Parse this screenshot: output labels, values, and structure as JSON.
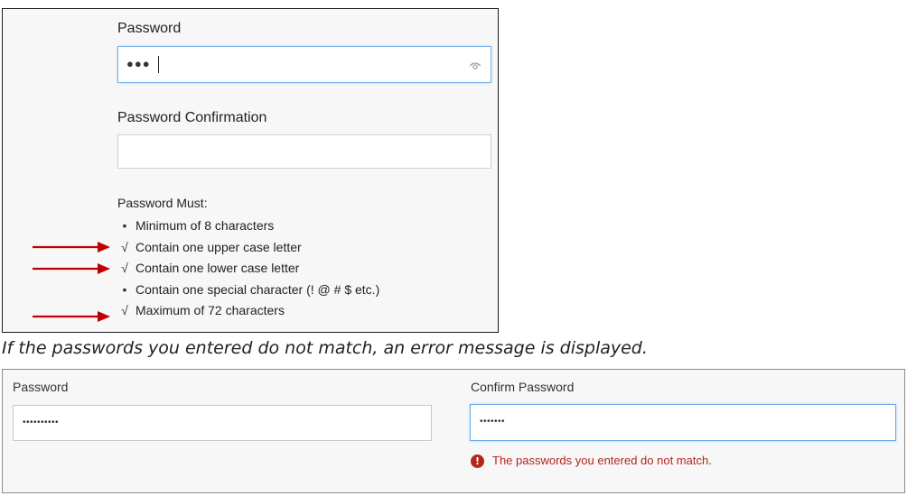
{
  "top_panel": {
    "password_label": "Password",
    "password_masked": "●●●",
    "confirmation_label": "Password Confirmation",
    "confirmation_value": "",
    "rules_title": "Password Must:",
    "rules": [
      {
        "mark": "•",
        "text": "Minimum of 8 characters",
        "met": false,
        "highlighted": false
      },
      {
        "mark": "√",
        "text": "Contain one upper case letter",
        "met": true,
        "highlighted": true
      },
      {
        "mark": "√",
        "text": "Contain one lower case letter",
        "met": true,
        "highlighted": true
      },
      {
        "mark": "•",
        "text": "Contain one special character (! @ # $ etc.)",
        "met": false,
        "highlighted": false
      },
      {
        "mark": "√",
        "text": "Maximum of 72 characters",
        "met": true,
        "highlighted": true
      }
    ],
    "arrow_color": "#c00000",
    "icons": {
      "password_toggle": "eye-icon",
      "pointer": "arrow-right-icon"
    }
  },
  "caption": "If the passwords you entered do not match, an error message is displayed.",
  "bottom_panel": {
    "password_label": "Password",
    "password_masked": "••••••••••",
    "confirm_label": "Confirm Password",
    "confirm_masked": "•••••••",
    "error_message": "The passwords you entered do not match.",
    "error_icon": "!",
    "error_color": "#b3261e",
    "icons": {
      "error": "error-icon"
    }
  }
}
